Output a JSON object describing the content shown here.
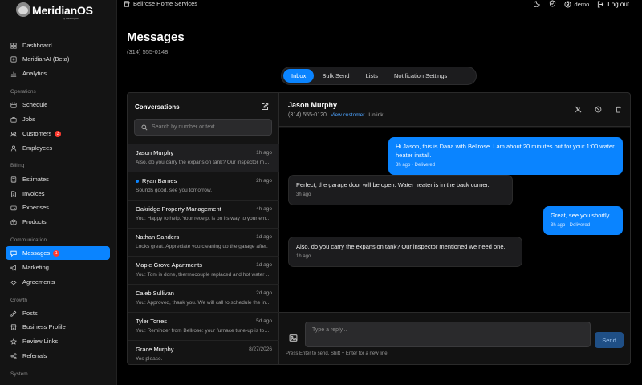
{
  "brand": {
    "name": "MeridianOS",
    "tagline": "by Bare Digital"
  },
  "sidebar": {
    "items": [
      {
        "label": "Dashboard",
        "icon": "grid-icon"
      },
      {
        "label": "MeridianAI (Beta)",
        "icon": "sparkle-icon"
      },
      {
        "label": "Analytics",
        "icon": "chart-icon"
      }
    ],
    "sections": [
      {
        "title": "Operations",
        "items": [
          {
            "label": "Schedule",
            "icon": "calendar-icon"
          },
          {
            "label": "Jobs",
            "icon": "briefcase-icon"
          },
          {
            "label": "Customers",
            "icon": "users-icon",
            "badge": "3"
          },
          {
            "label": "Employees",
            "icon": "user-icon"
          }
        ]
      },
      {
        "title": "Billing",
        "items": [
          {
            "label": "Estimates",
            "icon": "calculator-icon"
          },
          {
            "label": "Invoices",
            "icon": "file-icon"
          },
          {
            "label": "Expenses",
            "icon": "wallet-icon"
          },
          {
            "label": "Products",
            "icon": "box-icon"
          }
        ]
      },
      {
        "title": "Communication",
        "items": [
          {
            "label": "Messages",
            "icon": "message-icon",
            "badge": "1",
            "active": true
          },
          {
            "label": "Marketing",
            "icon": "megaphone-icon"
          },
          {
            "label": "Agreements",
            "icon": "handshake-icon"
          }
        ]
      },
      {
        "title": "Growth",
        "items": [
          {
            "label": "Posts",
            "icon": "post-icon"
          },
          {
            "label": "Business Profile",
            "icon": "store-icon"
          },
          {
            "label": "Review Links",
            "icon": "star-icon"
          },
          {
            "label": "Referrals",
            "icon": "share-icon"
          }
        ]
      },
      {
        "title": "System",
        "items": []
      }
    ]
  },
  "topbar": {
    "business_name": "Bellrose Home Services",
    "username": "demo",
    "logout_label": "Log out"
  },
  "page": {
    "title": "Messages",
    "phone": "(314) 555-0148"
  },
  "tabs": [
    {
      "label": "Inbox",
      "active": true
    },
    {
      "label": "Bulk Send"
    },
    {
      "label": "Lists"
    },
    {
      "label": "Notification Settings"
    }
  ],
  "conversations": {
    "title": "Conversations",
    "search_placeholder": "Search by number or text...",
    "items": [
      {
        "name": "Jason Murphy",
        "time": "1h ago",
        "preview": "Also, do you carry the expansion tank? Our inspector mentioned we need one.",
        "selected": true
      },
      {
        "name": "Ryan Barnes",
        "time": "2h ago",
        "preview": "Sounds good, see you tomorrow.",
        "unread": true
      },
      {
        "name": "Oakridge Property Management",
        "time": "4h ago",
        "preview": "You: Happy to help. Your receipt is on its way to your email."
      },
      {
        "name": "Nathan Sanders",
        "time": "1d ago",
        "preview": "Looks great. Appreciate you cleaning up the garage after."
      },
      {
        "name": "Maple Grove Apartments",
        "time": "1d ago",
        "preview": "You: Tom is done, thermocouple replaced and hot water is back."
      },
      {
        "name": "Caleb Sullivan",
        "time": "2d ago",
        "preview": "You: Approved, thank you. We will call to schedule the install."
      },
      {
        "name": "Tyler Torres",
        "time": "5d ago",
        "preview": "You: Reminder from Bellrose: your furnace tune-up is tomorrow."
      },
      {
        "name": "Grace Murphy",
        "time": "8/27/2026",
        "preview": "Yes please."
      }
    ]
  },
  "chat": {
    "name": "Jason Murphy",
    "phone": "(314) 555-0120",
    "view_customer": "View customer",
    "unlink": "Unlink",
    "messages": [
      {
        "direction": "out",
        "text": "Hi Jason, this is Dana with Bellrose. I am about 20 minutes out for your 1:00 water heater install.",
        "meta": "3h ago · Delivered"
      },
      {
        "direction": "in",
        "text": "Perfect, the garage door will be open. Water heater is in the back corner.",
        "meta": "3h ago"
      },
      {
        "direction": "out",
        "text": "Great, see you shortly.",
        "meta": "3h ago · Delivered"
      },
      {
        "direction": "in",
        "text": "Also, do you carry the expansion tank? Our inspector mentioned we need one.",
        "meta": "1h ago"
      }
    ],
    "reply_placeholder": "Type a reply...",
    "send_label": "Send",
    "hint": "Press Enter to send, Shift + Enter for a new line."
  },
  "colors": {
    "accent": "#0a84ff",
    "badge": "#ff3b30",
    "background": "#000000"
  }
}
